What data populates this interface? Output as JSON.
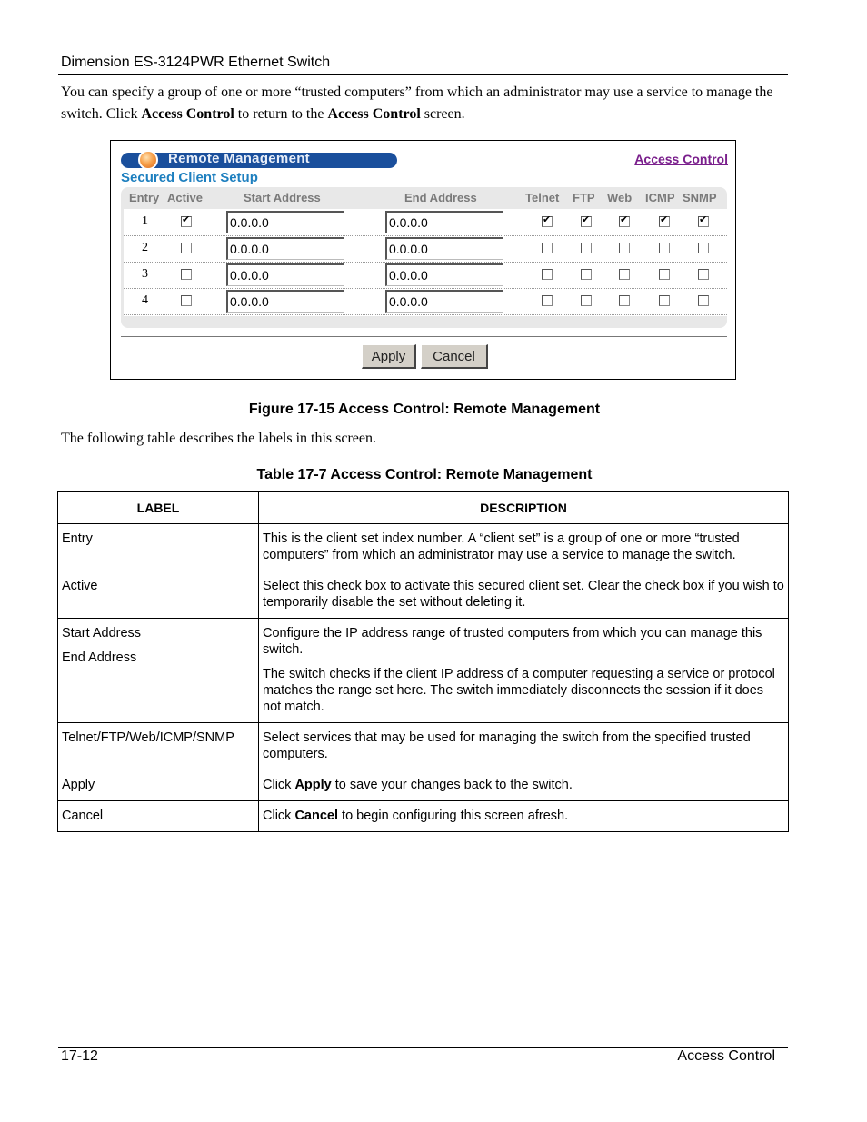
{
  "document": {
    "running_header": "Dimension ES-3124PWR Ethernet Switch",
    "intro": {
      "part1": "You can specify a group of one or more “trusted computers” from which an administrator may use a service to manage the switch. Click ",
      "bold1": "Access Control",
      "part2": " to return to the ",
      "bold2": "Access Control",
      "part3": " screen."
    },
    "figure_caption": "Figure 17-15 Access Control: Remote Management",
    "following_text": "The following table describes the labels in this screen.",
    "table_caption": "Table 17-7 Access Control: Remote Management",
    "footer": {
      "page_number": "17-12",
      "section": "Access Control"
    }
  },
  "screen": {
    "title": "Remote Management",
    "access_control_link": "Access Control",
    "subtitle": "Secured Client Setup",
    "columns": [
      "Entry",
      "Active",
      "Start Address",
      "End Address",
      "Telnet",
      "FTP",
      "Web",
      "ICMP",
      "SNMP"
    ],
    "rows": [
      {
        "entry": "1",
        "active": true,
        "start": "0.0.0.0",
        "end": "0.0.0.0",
        "telnet": true,
        "ftp": true,
        "web": true,
        "icmp": true,
        "snmp": true
      },
      {
        "entry": "2",
        "active": false,
        "start": "0.0.0.0",
        "end": "0.0.0.0",
        "telnet": false,
        "ftp": false,
        "web": false,
        "icmp": false,
        "snmp": false
      },
      {
        "entry": "3",
        "active": false,
        "start": "0.0.0.0",
        "end": "0.0.0.0",
        "telnet": false,
        "ftp": false,
        "web": false,
        "icmp": false,
        "snmp": false
      },
      {
        "entry": "4",
        "active": false,
        "start": "0.0.0.0",
        "end": "0.0.0.0",
        "telnet": false,
        "ftp": false,
        "web": false,
        "icmp": false,
        "snmp": false
      }
    ],
    "apply_label": "Apply",
    "cancel_label": "Cancel"
  },
  "desc_table": {
    "headers": {
      "label": "LABEL",
      "description": "DESCRIPTION"
    },
    "rows": [
      {
        "label": "Entry",
        "desc": "This is the client set index number. A “client set” is a group of one or more “trusted computers” from which an administrator may use a service to manage the switch."
      },
      {
        "label": "Active",
        "desc": "Select this check box to activate this secured client set. Clear the check box if you wish to temporarily disable the set without deleting it."
      },
      {
        "label": "Start Address",
        "label2": "End Address",
        "desc": "Configure the IP address range of trusted computers from which you can manage this switch.",
        "desc2": "The switch checks if the client IP address of a computer requesting a service or protocol matches the range set here. The switch immediately disconnects the session if it does not match."
      },
      {
        "label": "Telnet/FTP/Web/ICMP/SNMP",
        "desc": "Select services that may be used for managing the switch from the specified trusted computers."
      },
      {
        "label": "Apply",
        "desc_pre": "Click ",
        "desc_bold": "Apply",
        "desc_post": " to save your changes back to the switch."
      },
      {
        "label": "Cancel",
        "desc_pre": "Click ",
        "desc_bold": "Cancel",
        "desc_post": " to begin configuring this screen afresh."
      }
    ]
  },
  "colors": {
    "title_bar": "#1a4f9c",
    "subtitle": "#1d7fbf",
    "link": "#7a1f8c",
    "panel_bg": "#e8e8e8"
  }
}
